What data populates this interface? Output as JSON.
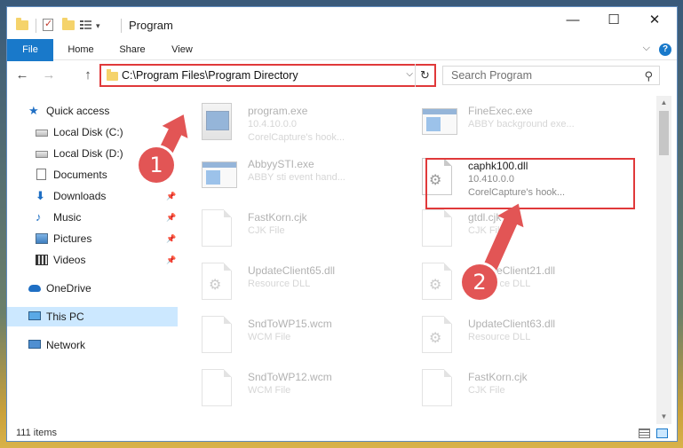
{
  "window": {
    "title": "Program",
    "controls": {
      "minimize": "—",
      "maximize": "☐",
      "close": "✕"
    }
  },
  "ribbon": {
    "tabs": [
      {
        "label": "File"
      },
      {
        "label": "Home"
      },
      {
        "label": "Share"
      },
      {
        "label": "View"
      }
    ],
    "help": "?"
  },
  "address_bar": {
    "path": "C:\\Program Files\\Program Directory",
    "refresh_icon": "↻",
    "dropdown_icon": "⌵"
  },
  "search": {
    "placeholder": "Search Program",
    "icon": "⚲"
  },
  "nav": {
    "back": "←",
    "forward": "→",
    "up": "↑"
  },
  "sidebar": {
    "items": [
      {
        "label": "Quick access",
        "icon": "star-icon"
      },
      {
        "label": "Local Disk (C:)",
        "icon": "drive-icon"
      },
      {
        "label": "Local Disk (D:)",
        "icon": "drive-icon"
      },
      {
        "label": "Documents",
        "icon": "document-icon"
      },
      {
        "label": "Downloads",
        "icon": "download-icon"
      },
      {
        "label": "Music",
        "icon": "music-icon"
      },
      {
        "label": "Pictures",
        "icon": "pictures-icon"
      },
      {
        "label": "Videos",
        "icon": "videos-icon"
      },
      {
        "label": "OneDrive",
        "icon": "cloud-icon"
      },
      {
        "label": "This PC",
        "icon": "computer-icon"
      },
      {
        "label": "Network",
        "icon": "network-icon"
      }
    ],
    "pin_glyph": "📌"
  },
  "files": {
    "left": [
      {
        "name": "program.exe",
        "line1": "10.4.10.0.0",
        "line2": "CorelCapture's hook..."
      },
      {
        "name": "AbbyySTI.exe",
        "line1": "ABBY sti event hand...",
        "line2": ""
      },
      {
        "name": "FastKorn.cjk",
        "line1": "CJK File",
        "line2": ""
      },
      {
        "name": "UpdateClient65.dll",
        "line1": "Resource DLL",
        "line2": ""
      },
      {
        "name": "SndToWP15.wcm",
        "line1": "WCM File",
        "line2": ""
      },
      {
        "name": "SndToWP12.wcm",
        "line1": "WCM File",
        "line2": ""
      }
    ],
    "right": [
      {
        "name": "FineExec.exe",
        "line1": "ABBY background exe...",
        "line2": ""
      },
      {
        "name": "caphk100.dll",
        "line1": "10.410.0.0",
        "line2": "CorelCapture's hook..."
      },
      {
        "name": "gtdl.cjk",
        "line1": "CJK File",
        "line2": ""
      },
      {
        "name": "UpdateClient21.dll",
        "line1": "Resource DLL",
        "line2": ""
      },
      {
        "name": "UpdateClient63.dll",
        "line1": "Resource DLL",
        "line2": ""
      },
      {
        "name": "FastKorn.cjk",
        "line1": "CJK File",
        "line2": ""
      }
    ]
  },
  "annotations": {
    "step1": "1",
    "step2": "2"
  },
  "status": {
    "item_count": "111 items"
  },
  "colors": {
    "accent": "#1979ca",
    "annotation": "#e25555",
    "highlight_border": "#e0393a"
  }
}
